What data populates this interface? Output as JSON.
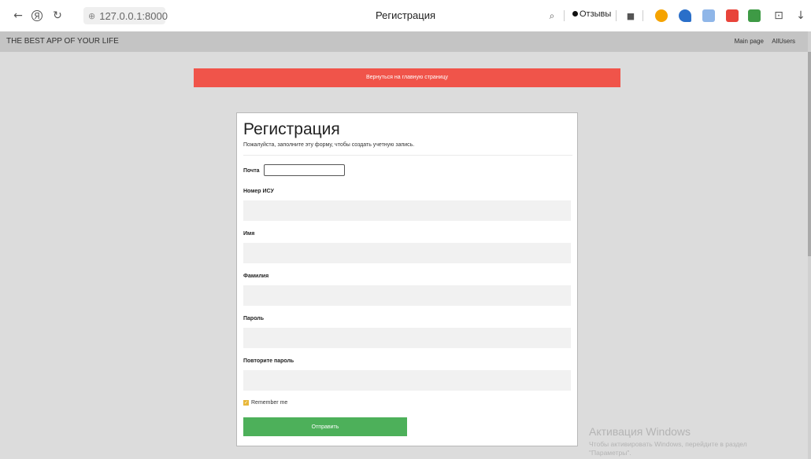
{
  "browser": {
    "url": "127.0.0.1:8000",
    "tab_title": "Регистрация",
    "reviews_label": "Отзывы",
    "icons": [
      "back-arrow-icon",
      "yandex-icon",
      "reload-icon",
      "site-info-icon",
      "search-icon",
      "bookmark-icon",
      "download-icon"
    ]
  },
  "app": {
    "brand": "THE BEST APP OF YOUR LIFE",
    "nav": [
      "Main page",
      "AllUsers"
    ]
  },
  "back_button": "Вернуться на главную страницу",
  "form": {
    "title": "Регистрация",
    "subtitle": "Пожалуйста, заполните эту форму, чтобы создать учетную запись.",
    "email_label": "Почта",
    "fields": [
      {
        "label": "Номер ИСУ",
        "value": ""
      },
      {
        "label": "Имя",
        "value": ""
      },
      {
        "label": "Фамилия",
        "value": ""
      },
      {
        "label": "Пароль",
        "value": ""
      },
      {
        "label": "Повторите пароль",
        "value": ""
      }
    ],
    "remember_label": "Remember me",
    "remember_checked": true,
    "submit_label": "Отправить"
  },
  "watermark": {
    "title": "Активация Windows",
    "line1": "Чтобы активировать Windows, перейдите в раздел",
    "line2": "\"Параметры\"."
  },
  "colors": {
    "back_button": "#f0544a",
    "submit_button": "#4db05a",
    "header": "#c4c4c4",
    "background": "#dcdcdc"
  }
}
